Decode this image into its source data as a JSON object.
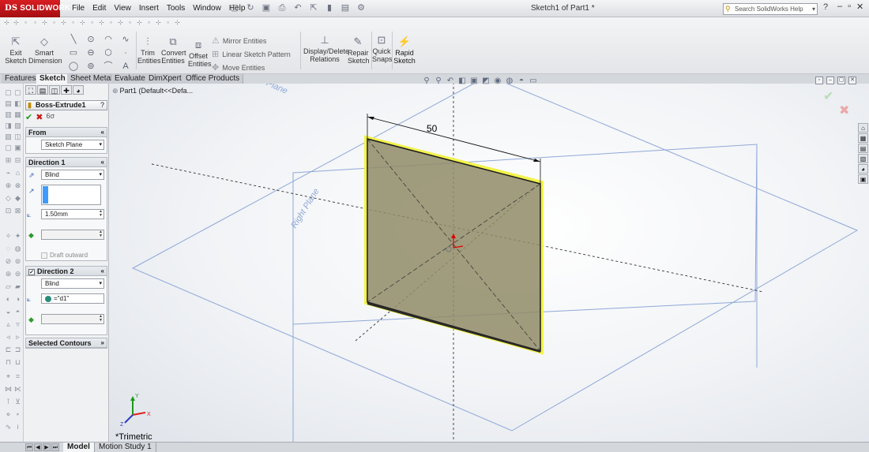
{
  "app": {
    "brand": "SOLIDWORKS",
    "brand_mark": "DS",
    "doc_title": "Sketch1 of Part1 *",
    "menus": [
      "File",
      "Edit",
      "View",
      "Insert",
      "Tools",
      "Window",
      "Help"
    ],
    "search_placeholder": "Search SolidWorks Help"
  },
  "toolbar": {
    "exit_sketch": "Exit Sketch",
    "smart_dimension": "Smart Dimension",
    "trim_entities": "Trim Entities",
    "convert_entities": "Convert Entities",
    "offset_entities": "Offset Entities",
    "mirror_entities": "Mirror Entities",
    "linear_sketch_pattern": "Linear Sketch Pattern",
    "move_entities": "Move Entities",
    "display_delete_relations": "Display/Delete Relations",
    "repair_sketch": "Repair Sketch",
    "quick_snaps": "Quick Snaps",
    "rapid_sketch": "Rapid Sketch"
  },
  "tabs": [
    "Features",
    "Sketch",
    "Sheet Metal",
    "Evaluate",
    "DimXpert",
    "Office Products"
  ],
  "active_tab": "Sketch",
  "property_manager": {
    "title": "Boss-Extrude1",
    "help": "?",
    "from": {
      "header": "From",
      "value": "Sketch Plane"
    },
    "direction1": {
      "header": "Direction 1",
      "end_condition": "Blind",
      "depth": "1.50mm",
      "draft_outward": "Draft outward"
    },
    "direction2": {
      "header": "Direction 2",
      "end_condition": "Blind",
      "depth": "=\"d1\""
    },
    "selected_contours": {
      "header": "Selected Contours"
    }
  },
  "viewport": {
    "tree_node": "Part1  (Default<<Defa...",
    "dimension_value": "50",
    "plane_labels": {
      "right": "Right Plane",
      "top": "p Plane"
    },
    "view_label": "*Trimetric",
    "colors": {
      "sketch_fill": "#8f8b66",
      "highlight": "#f1f24a",
      "plane_line": "#8fa8d8"
    }
  },
  "bottom_tabs": [
    "Model",
    "Motion Study 1"
  ],
  "active_bottom_tab": "Model"
}
